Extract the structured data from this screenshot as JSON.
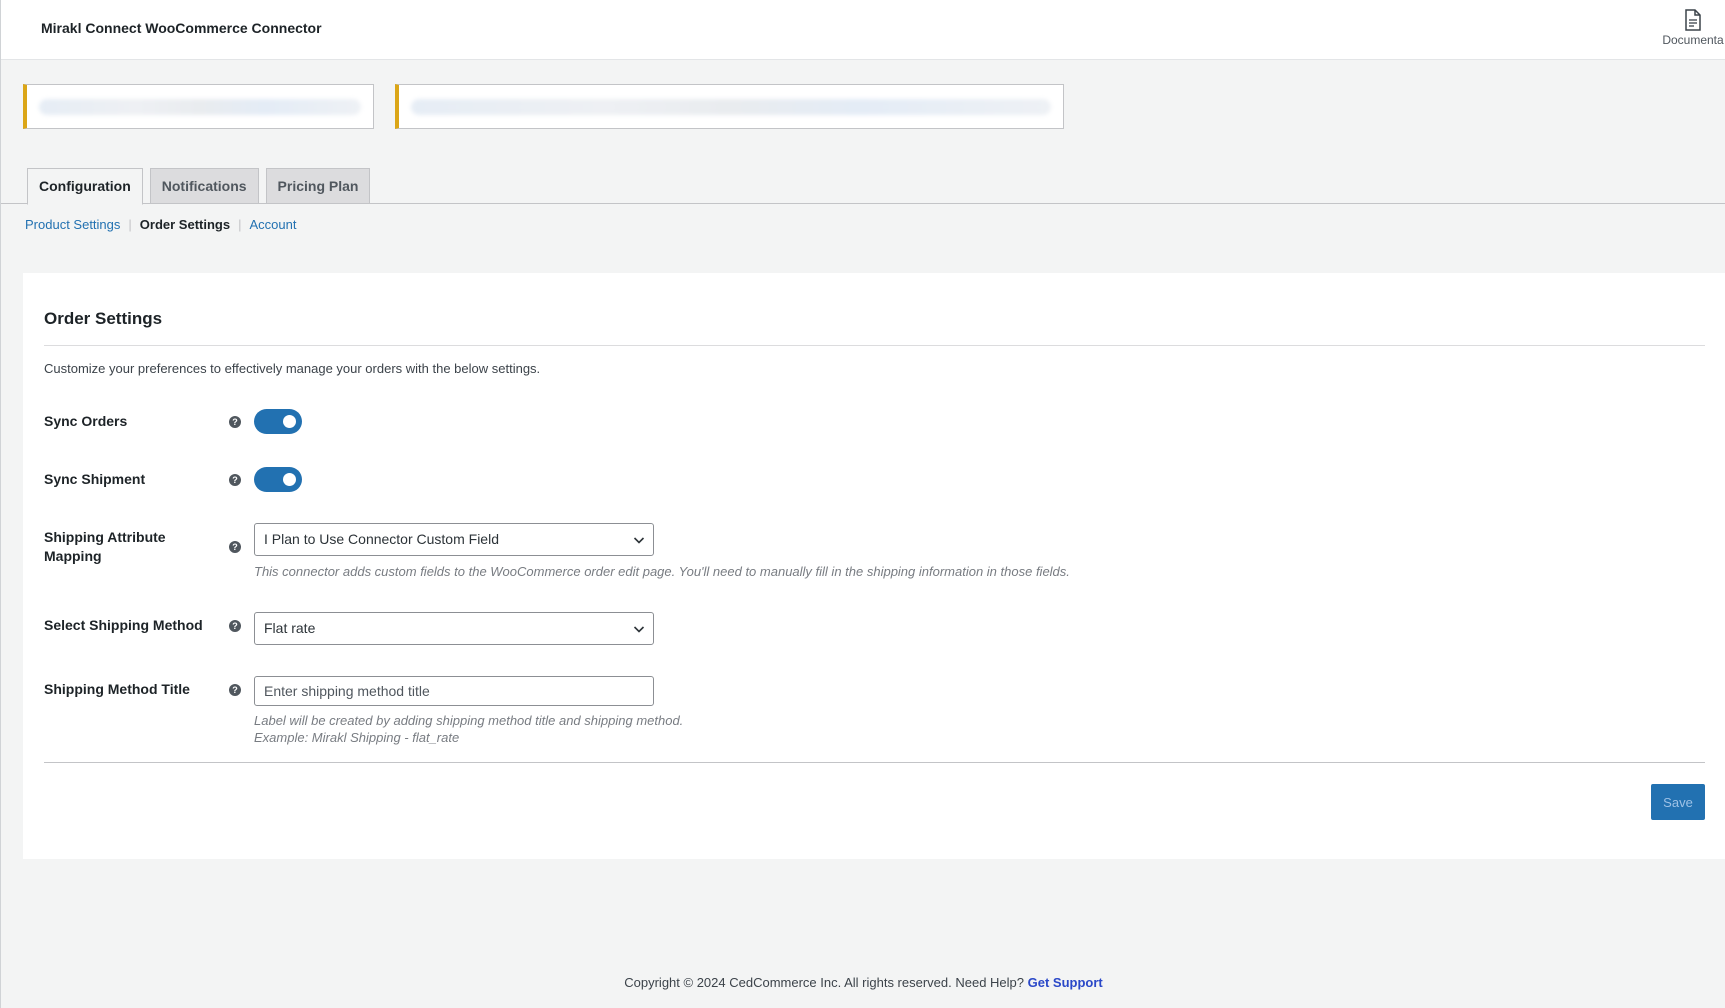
{
  "header": {
    "title": "Mirakl Connect WooCommerce Connector",
    "documentation_label": "Documenta",
    "documentation_icon": "document-icon"
  },
  "tabs": [
    {
      "label": "Configuration",
      "active": true
    },
    {
      "label": "Notifications",
      "active": false
    },
    {
      "label": "Pricing Plan",
      "active": false
    }
  ],
  "subnav": {
    "items": [
      "Product Settings",
      "Order Settings",
      "Account"
    ],
    "current": "Order Settings"
  },
  "section": {
    "title": "Order Settings",
    "description": "Customize your preferences to effectively manage your orders with the below settings."
  },
  "fields": {
    "sync_orders": {
      "label": "Sync Orders",
      "enabled": true
    },
    "sync_shipment": {
      "label": "Sync Shipment",
      "enabled": true
    },
    "shipping_attribute_mapping": {
      "label_line1": "Shipping Attribute",
      "label_line2": "Mapping",
      "value": "I Plan to Use Connector Custom Field",
      "hint": "This connector adds custom fields to the WooCommerce order edit page. You'll need to manually fill in the shipping information in those fields."
    },
    "select_shipping_method": {
      "label": "Select Shipping Method",
      "value": "Flat rate"
    },
    "shipping_method_title": {
      "label": "Shipping Method Title",
      "value": "",
      "placeholder": "Enter shipping method title",
      "hint_line1": "Label will be created by adding shipping method title and shipping method.",
      "hint_line2": "Example: Mirakl Shipping - flat_rate"
    }
  },
  "actions": {
    "save_label": "Save"
  },
  "footer": {
    "text": "Copyright © 2024 CedCommerce Inc. All rights reserved. Need Help?",
    "link": "Get Support"
  },
  "colors": {
    "accent": "#2271b1",
    "notice_border": "#dba617",
    "footer_link": "#2a48c8"
  }
}
